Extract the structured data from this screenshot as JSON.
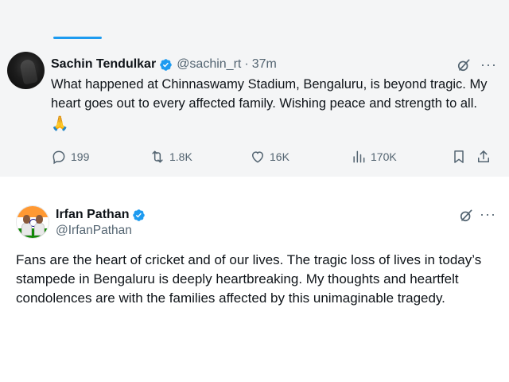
{
  "colors": {
    "accent": "#1d9bf0",
    "secondary_text": "#536471",
    "card1_bg": "#f4f5f6"
  },
  "tweet1": {
    "author_name": "Sachin Tendulkar",
    "handle": "@sachin_rt",
    "separator": "·",
    "time": "37m",
    "text": "What happened at Chinnaswamy Stadium, Bengaluru, is beyond tragic. My heart goes out to every affected family. Wishing peace and strength to all.",
    "emoji": "🙏",
    "more_label": "···",
    "icons": {
      "verified": "verified-badge-icon",
      "grok": "grok-icon",
      "more": "more-icon"
    },
    "actions": {
      "replies": "199",
      "reposts": "1.8K",
      "likes": "16K",
      "views": "170K"
    }
  },
  "tweet2": {
    "author_name": "Irfan Pathan",
    "handle": "@IrfanPathan",
    "text": "Fans are the heart of cricket and of our lives. The tragic loss of lives in today’s stampede in Bengaluru is deeply heartbreaking. My thoughts and heartfelt condolences are with the families affected by this unimaginable tragedy.",
    "more_label": "···",
    "icons": {
      "verified": "verified-badge-icon",
      "grok": "grok-icon",
      "more": "more-icon"
    }
  }
}
